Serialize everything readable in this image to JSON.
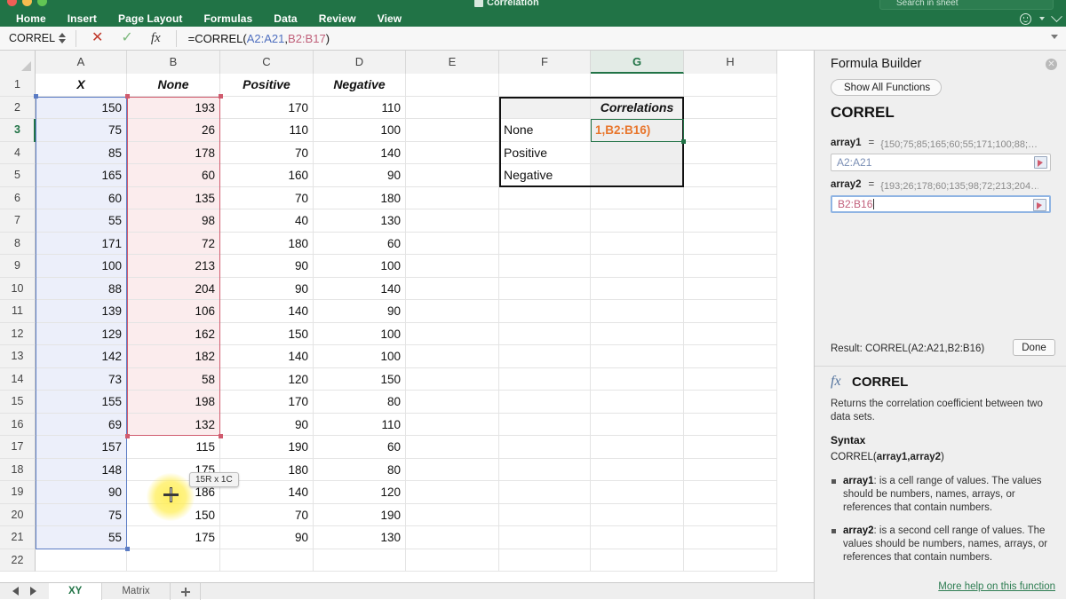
{
  "titlebar": {
    "doc_title": "Correlation",
    "search_placeholder": "Search in sheet"
  },
  "ribbon": {
    "tabs": [
      "Home",
      "Insert",
      "Page Layout",
      "Formulas",
      "Data",
      "Review",
      "View"
    ]
  },
  "formula_bar": {
    "name_box": "CORREL",
    "cancel_icon": "✕",
    "accept_icon": "✓",
    "fx_icon": "fx",
    "formula_prefix": "=CORREL(",
    "formula_ref1": "A2:A21",
    "formula_comma": ",",
    "formula_ref2": "B2:B17",
    "formula_suffix": ")"
  },
  "grid": {
    "columns": [
      "A",
      "B",
      "C",
      "D",
      "E",
      "F",
      "G",
      "H"
    ],
    "active_column": "G",
    "active_row": "3",
    "row_numbers": [
      "1",
      "2",
      "3",
      "4",
      "5",
      "6",
      "7",
      "8",
      "9",
      "10",
      "11",
      "12",
      "13",
      "14",
      "15",
      "16",
      "17",
      "18",
      "19",
      "20",
      "21",
      "22"
    ],
    "headers": {
      "A": "X",
      "B": "None",
      "C": "Positive",
      "D": "Negative"
    },
    "data": {
      "A": [
        "150",
        "75",
        "85",
        "165",
        "60",
        "55",
        "171",
        "100",
        "88",
        "139",
        "129",
        "142",
        "73",
        "155",
        "69",
        "157",
        "148",
        "90",
        "75",
        "55"
      ],
      "B": [
        "193",
        "26",
        "178",
        "60",
        "135",
        "98",
        "72",
        "213",
        "204",
        "106",
        "162",
        "182",
        "58",
        "198",
        "132",
        "115",
        "175",
        "186",
        "150",
        "175"
      ],
      "C": [
        "170",
        "110",
        "70",
        "160",
        "70",
        "40",
        "180",
        "90",
        "90",
        "140",
        "150",
        "140",
        "120",
        "170",
        "90",
        "190",
        "180",
        "140",
        "70",
        "90"
      ],
      "D": [
        "110",
        "100",
        "140",
        "90",
        "180",
        "130",
        "60",
        "100",
        "140",
        "90",
        "100",
        "100",
        "150",
        "80",
        "110",
        "60",
        "80",
        "120",
        "190",
        "130"
      ]
    },
    "correlations_box": {
      "title": "Correlations",
      "rows": [
        "None",
        "Positive",
        "Negative"
      ],
      "values": [
        "1,B2:B16)",
        "",
        ""
      ]
    },
    "selection_tooltip": "15R x 1C"
  },
  "formula_builder": {
    "title": "Formula Builder",
    "close_icon": "✕",
    "show_all_functions": "Show All Functions",
    "function_name": "CORREL",
    "args": [
      {
        "label": "array1",
        "equals": "=",
        "preview": "{150;75;85;165;60;55;171;100;88;…",
        "value": "A2:A21",
        "focused": false
      },
      {
        "label": "array2",
        "equals": "=",
        "preview": "{193;26;178;60;135;98;72;213;204…",
        "value": "B2:B16",
        "focused": true
      }
    ],
    "result_label": "Result: CORREL(A2:A21,B2:B16)",
    "done_label": "Done",
    "fx_icon": "fx",
    "help_function_name": "CORREL",
    "description": "Returns the correlation coefficient between two data sets.",
    "syntax_heading": "Syntax",
    "syntax_prefix": "CORREL(",
    "syntax_args": "array1,array2",
    "syntax_suffix": ")",
    "bullets": [
      {
        "term": "array1",
        "text": ": is a cell range of values. The values should be numbers, names, arrays, or references that contain numbers."
      },
      {
        "term": "array2",
        "text": ": is a second cell range of values. The values should be numbers, names, arrays, or references that contain numbers."
      }
    ],
    "more_help": "More help on this function"
  },
  "sheet_tabs": {
    "tabs": [
      "XY",
      "Matrix"
    ],
    "active": "XY",
    "add_label": "+"
  },
  "colors": {
    "brand_green": "#217346",
    "selection_blue": "#5b7cc4",
    "selection_red": "#d05b6e",
    "active_orange": "#e8762c"
  }
}
